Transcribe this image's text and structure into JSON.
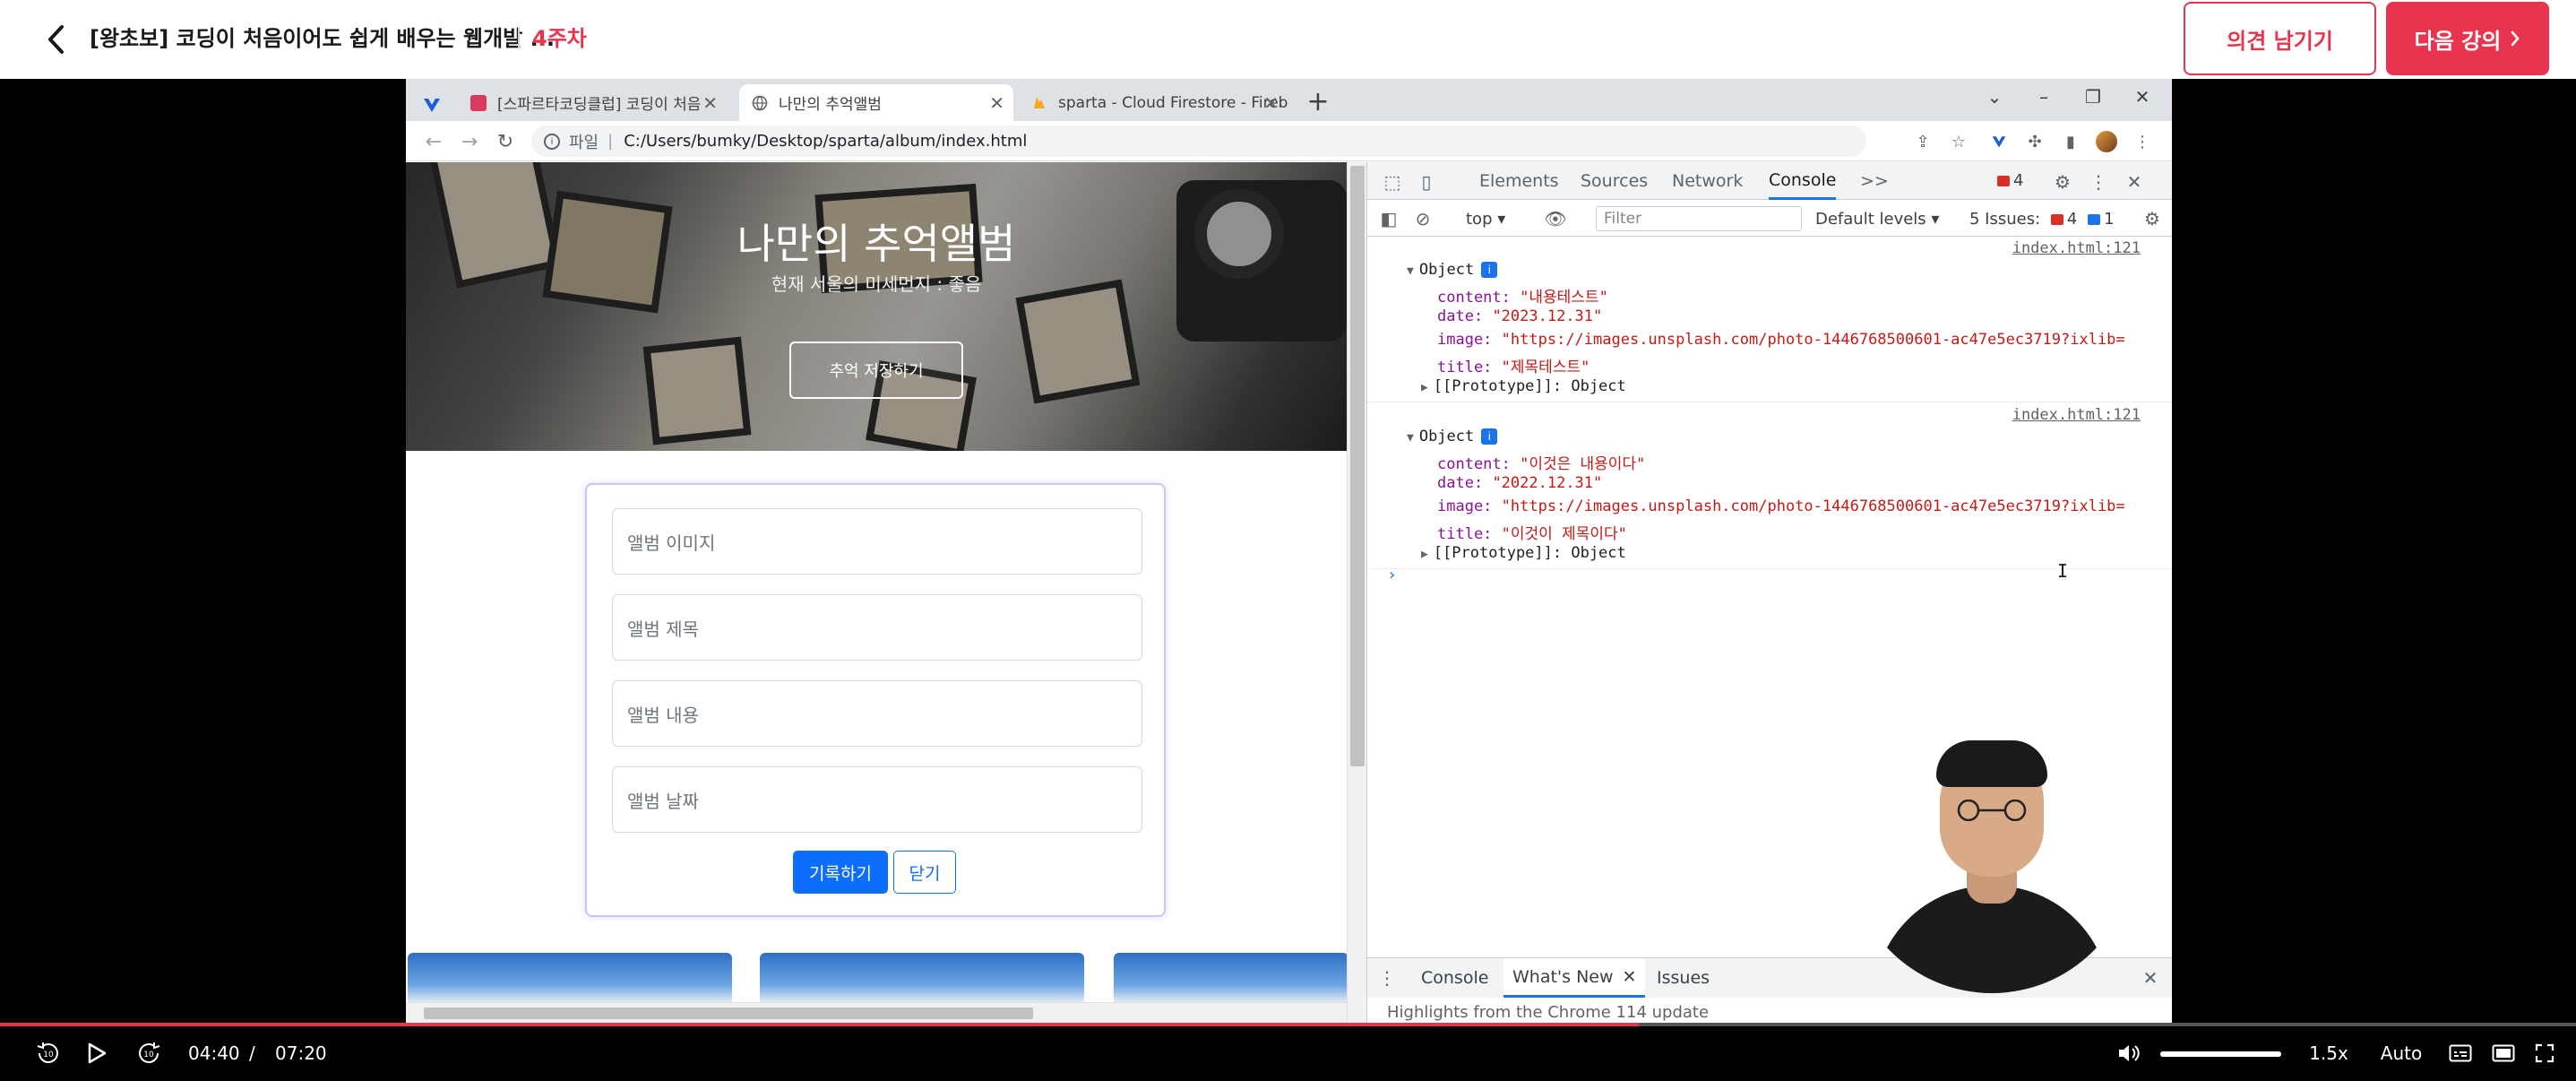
{
  "course": {
    "title": "[왕초보] 코딩이 처음이어도 쉽게 배우는 웹개발 ...",
    "week": "4주차",
    "feedback_label": "의견 남기기",
    "next_label": "다음 강의",
    "accent": "#e8344e"
  },
  "browser": {
    "tabs": [
      {
        "label": "[스파르타코딩클럽] 코딩이 처음"
      },
      {
        "label": "나만의 추억앨범"
      },
      {
        "label": "sparta - Cloud Firestore - Firebas"
      }
    ],
    "address": {
      "scheme": "파일",
      "path": "C:/Users/bumky/Desktop/sparta/album/index.html"
    }
  },
  "page": {
    "hero_title": "나만의 추억앨범",
    "hero_sub": "현재 서울의 미세먼지 : 좋음",
    "save_button": "추억 저장하기",
    "form": {
      "image_placeholder": "앨범 이미지",
      "title_placeholder": "앨범 제목",
      "content_placeholder": "앨범 내용",
      "date_placeholder": "앨범 날짜",
      "submit_label": "기록하기",
      "close_label": "닫기"
    }
  },
  "devtools": {
    "tabs": [
      "Elements",
      "Sources",
      "Network",
      "Console"
    ],
    "more": ">>",
    "error_count": "4",
    "context": "top",
    "filter_placeholder": "Filter",
    "levels": "Default levels",
    "issues_label": "5 Issues:",
    "issues_errors": "4",
    "issues_info": "1",
    "logs": [
      {
        "source": "index.html:121",
        "object_label": "Object",
        "content": "\"내용테스트\"",
        "date": "\"2023.12.31\"",
        "image": "\"https://images.unsplash.com/photo-1446768500601-ac47e5ec3719?ixlib=",
        "title": "\"제목테스트\"",
        "prototype": "[[Prototype]]: Object"
      },
      {
        "source": "index.html:121",
        "object_label": "Object",
        "content": "\"이것은 내용이다\"",
        "date": "\"2022.12.31\"",
        "image": "\"https://images.unsplash.com/photo-1446768500601-ac47e5ec3719?ixlib=",
        "title": "\"이것이 제목이다\"",
        "prototype": "[[Prototype]]: Object"
      }
    ],
    "keys": {
      "content": "content:",
      "date": "date:",
      "image": "image:",
      "title": "title:"
    },
    "prompt": "›",
    "drawer_tabs": [
      "Console",
      "What's New",
      "Issues"
    ],
    "drawer_body": "Highlights from the Chrome 114 update"
  },
  "player": {
    "current_time": "04:40",
    "separator": "/",
    "total_time": "07:20",
    "progress_fraction": 0.636,
    "volume_fraction": 1.0,
    "speed": "1.5x",
    "quality": "Auto",
    "skip_back": "10",
    "skip_forward": "10"
  }
}
